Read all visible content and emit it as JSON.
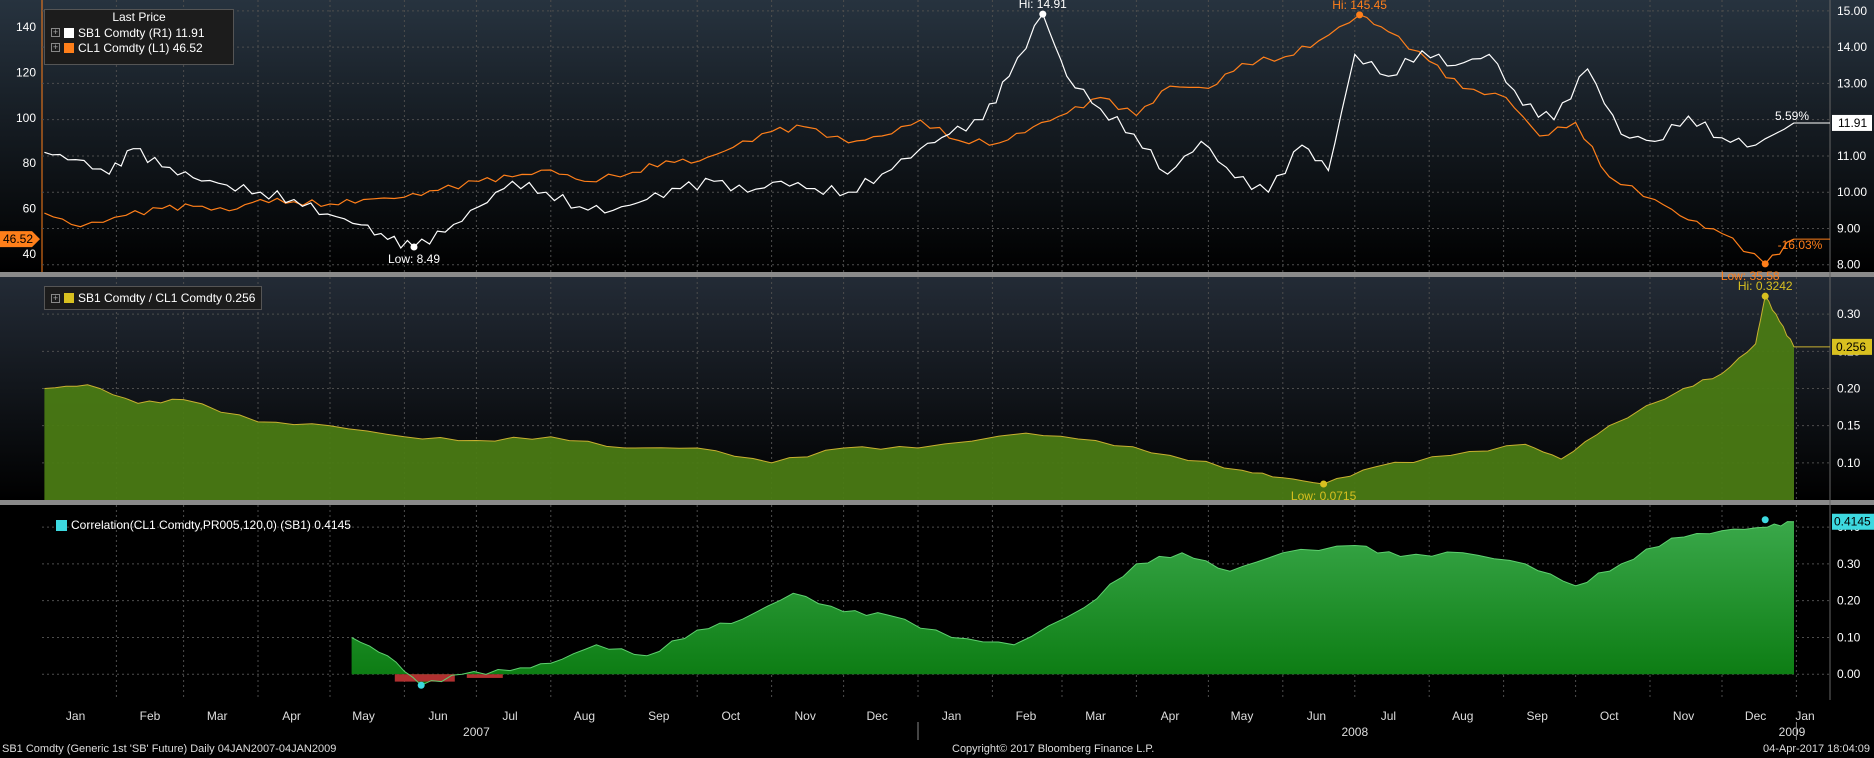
{
  "colors": {
    "sugar": "#ffffff",
    "crude": "#ff7f1a",
    "ratio_fill": "#4a7a14",
    "ratio_line": "#c8b030",
    "corr_fill": "#1f9a25",
    "corr_line": "#3dd9e0",
    "neg": "#b03030"
  },
  "legend_top": {
    "title": "Last Price",
    "items": [
      {
        "label": "SB1 Comdty  (R1) 11.91",
        "color": "#ffffff"
      },
      {
        "label": "CL1 Comdty  (L1) 46.52",
        "color": "#ff7f1a"
      }
    ]
  },
  "legend_mid": {
    "label": "SB1 Comdty / CL1 Comdty 0.256",
    "color": "#d8c020"
  },
  "legend_bot": {
    "label": "Correlation(CL1 Comdty,PR005,120,0) (SB1) 0.4145",
    "color": "#3dd9e0"
  },
  "footer": {
    "left": "SB1 Comdty (Generic 1st 'SB' Future)  Daily 04JAN2007-04JAN2009",
    "center": "Copyright© 2017 Bloomberg Finance L.P.",
    "right": "04-Apr-2017 18:04:09"
  },
  "chart_data": [
    {
      "type": "line",
      "panel": "price",
      "x_domain": [
        "2007-01-01",
        "2009-01-15"
      ],
      "y_left_ticks": [
        40,
        60,
        80,
        100,
        120,
        140
      ],
      "y_left_range": [
        32,
        152
      ],
      "y_right_ticks": [
        "8.00",
        "9.00",
        "10.00",
        "11.00",
        "12.00",
        "13.00",
        "14.00",
        "15.00"
      ],
      "y_right_range": [
        7.8,
        15.3
      ],
      "series": [
        {
          "name": "SB1 Comdty (R1)",
          "axis": "right",
          "last": "11.91",
          "points": [
            [
              "2007-01-02",
              11.1
            ],
            [
              "2007-01-15",
              10.9
            ],
            [
              "2007-01-29",
              10.5
            ],
            [
              "2007-02-08",
              11.2
            ],
            [
              "2007-02-20",
              10.7
            ],
            [
              "2007-03-05",
              10.4
            ],
            [
              "2007-03-19",
              10.2
            ],
            [
              "2007-04-02",
              10.0
            ],
            [
              "2007-04-16",
              9.8
            ],
            [
              "2007-04-30",
              9.4
            ],
            [
              "2007-05-14",
              9.1
            ],
            [
              "2007-05-25",
              8.7
            ],
            [
              "2007-06-05",
              8.49
            ],
            [
              "2007-06-18",
              8.9
            ],
            [
              "2007-07-02",
              9.6
            ],
            [
              "2007-07-16",
              10.3
            ],
            [
              "2007-07-30",
              10.0
            ],
            [
              "2007-08-13",
              9.6
            ],
            [
              "2007-08-27",
              9.5
            ],
            [
              "2007-09-10",
              9.8
            ],
            [
              "2007-09-24",
              10.1
            ],
            [
              "2007-10-08",
              10.3
            ],
            [
              "2007-10-22",
              10.0
            ],
            [
              "2007-11-05",
              10.3
            ],
            [
              "2007-11-19",
              10.1
            ],
            [
              "2007-12-03",
              10.0
            ],
            [
              "2007-12-17",
              10.5
            ],
            [
              "2008-01-02",
              11.2
            ],
            [
              "2008-01-14",
              11.6
            ],
            [
              "2008-01-28",
              12.0
            ],
            [
              "2008-02-08",
              13.2
            ],
            [
              "2008-02-22",
              14.91
            ],
            [
              "2008-03-03",
              13.2
            ],
            [
              "2008-03-17",
              12.3
            ],
            [
              "2008-03-31",
              11.6
            ],
            [
              "2008-04-14",
              10.5
            ],
            [
              "2008-04-28",
              11.4
            ],
            [
              "2008-05-12",
              10.4
            ],
            [
              "2008-05-26",
              10.0
            ],
            [
              "2008-06-09",
              11.3
            ],
            [
              "2008-06-20",
              10.6
            ],
            [
              "2008-07-01",
              13.8
            ],
            [
              "2008-07-15",
              13.2
            ],
            [
              "2008-07-29",
              13.9
            ],
            [
              "2008-08-12",
              13.5
            ],
            [
              "2008-08-26",
              13.8
            ],
            [
              "2008-09-09",
              12.4
            ],
            [
              "2008-09-22",
              12.0
            ],
            [
              "2008-10-06",
              13.4
            ],
            [
              "2008-10-20",
              11.6
            ],
            [
              "2008-11-03",
              11.4
            ],
            [
              "2008-11-17",
              12.1
            ],
            [
              "2008-12-01",
              11.5
            ],
            [
              "2008-12-15",
              11.3
            ],
            [
              "2008-12-31",
              11.91
            ]
          ]
        },
        {
          "name": "CL1 Comdty (L1)",
          "axis": "left",
          "last": "46.52",
          "points": [
            [
              "2007-01-02",
              58
            ],
            [
              "2007-01-17",
              52
            ],
            [
              "2007-02-05",
              57
            ],
            [
              "2007-02-20",
              60
            ],
            [
              "2007-03-05",
              61
            ],
            [
              "2007-03-20",
              59
            ],
            [
              "2007-04-02",
              64
            ],
            [
              "2007-04-16",
              63
            ],
            [
              "2007-05-01",
              62
            ],
            [
              "2007-05-15",
              64
            ],
            [
              "2007-06-01",
              65
            ],
            [
              "2007-06-15",
              68
            ],
            [
              "2007-07-02",
              72
            ],
            [
              "2007-07-16",
              74
            ],
            [
              "2007-08-01",
              77
            ],
            [
              "2007-08-15",
              72
            ],
            [
              "2007-09-04",
              76
            ],
            [
              "2007-09-18",
              81
            ],
            [
              "2007-10-02",
              81
            ],
            [
              "2007-10-16",
              87
            ],
            [
              "2007-11-01",
              94
            ],
            [
              "2007-11-15",
              96
            ],
            [
              "2007-12-03",
              89
            ],
            [
              "2007-12-17",
              92
            ],
            [
              "2008-01-02",
              99
            ],
            [
              "2008-01-18",
              90
            ],
            [
              "2008-02-04",
              89
            ],
            [
              "2008-02-18",
              96
            ],
            [
              "2008-03-03",
              102
            ],
            [
              "2008-03-17",
              109
            ],
            [
              "2008-04-01",
              101
            ],
            [
              "2008-04-15",
              114
            ],
            [
              "2008-05-01",
              113
            ],
            [
              "2008-05-15",
              124
            ],
            [
              "2008-06-02",
              127
            ],
            [
              "2008-06-16",
              134
            ],
            [
              "2008-07-03",
              145.45
            ],
            [
              "2008-07-15",
              138
            ],
            [
              "2008-08-01",
              125
            ],
            [
              "2008-08-15",
              113
            ],
            [
              "2008-09-02",
              109
            ],
            [
              "2008-09-16",
              92
            ],
            [
              "2008-10-01",
              98
            ],
            [
              "2008-10-15",
              74
            ],
            [
              "2008-11-03",
              64
            ],
            [
              "2008-11-17",
              55
            ],
            [
              "2008-12-01",
              49
            ],
            [
              "2008-12-19",
              35.58
            ],
            [
              "2008-12-31",
              46.52
            ]
          ]
        }
      ],
      "annotations": [
        {
          "text": "Hi: 14.91",
          "x": "2008-02-22",
          "y": 14.91,
          "axis": "right"
        },
        {
          "text": "Low: 8.49",
          "x": "2007-06-05",
          "y": 8.49,
          "axis": "right"
        },
        {
          "text": "Hi: 145.45",
          "x": "2008-07-03",
          "y": 145.45,
          "axis": "left"
        },
        {
          "text": "Low: 35.58",
          "x": "2008-12-19",
          "y": 35.58,
          "axis": "left"
        },
        {
          "text": "5.59%",
          "series": "SB1"
        },
        {
          "text": "-16.03%",
          "series": "CL1"
        }
      ]
    },
    {
      "type": "area",
      "panel": "ratio",
      "series_name": "SB1 Comdty / CL1 Comdty",
      "last": "0.256",
      "y_ticks": [
        "0.10",
        "0.15",
        "0.20",
        "0.25",
        "0.30"
      ],
      "y_range": [
        0.05,
        0.35
      ],
      "points": [
        [
          "2007-01-02",
          0.2
        ],
        [
          "2007-01-20",
          0.205
        ],
        [
          "2007-02-10",
          0.18
        ],
        [
          "2007-03-01",
          0.185
        ],
        [
          "2007-04-01",
          0.155
        ],
        [
          "2007-05-01",
          0.15
        ],
        [
          "2007-06-01",
          0.135
        ],
        [
          "2007-07-01",
          0.13
        ],
        [
          "2007-08-01",
          0.135
        ],
        [
          "2007-09-01",
          0.12
        ],
        [
          "2007-10-01",
          0.12
        ],
        [
          "2007-11-01",
          0.1
        ],
        [
          "2007-12-01",
          0.12
        ],
        [
          "2008-01-01",
          0.12
        ],
        [
          "2008-02-15",
          0.14
        ],
        [
          "2008-03-15",
          0.13
        ],
        [
          "2008-04-15",
          0.11
        ],
        [
          "2008-05-15",
          0.09
        ],
        [
          "2008-06-01",
          0.08
        ],
        [
          "2008-06-18",
          0.0715
        ],
        [
          "2008-07-10",
          0.095
        ],
        [
          "2008-08-10",
          0.11
        ],
        [
          "2008-09-10",
          0.125
        ],
        [
          "2008-09-25",
          0.105
        ],
        [
          "2008-10-15",
          0.15
        ],
        [
          "2008-11-15",
          0.2
        ],
        [
          "2008-12-01",
          0.22
        ],
        [
          "2008-12-15",
          0.26
        ],
        [
          "2008-12-19",
          0.3242
        ],
        [
          "2008-12-25",
          0.29
        ],
        [
          "2008-12-31",
          0.256
        ]
      ],
      "annotations": [
        {
          "text": "Hi: 0.3242",
          "x": "2008-12-19",
          "y": 0.3242
        },
        {
          "text": "Low: 0.0715",
          "x": "2008-06-18",
          "y": 0.0715
        }
      ]
    },
    {
      "type": "area",
      "panel": "correlation",
      "series_name": "Correlation(CL1 Comdty,PR005,120,0) (SB1)",
      "last": "0.4145",
      "y_ticks": [
        "0.00",
        "0.10",
        "0.20",
        "0.30",
        "0.40"
      ],
      "y_range": [
        -0.07,
        0.46
      ],
      "points": [
        [
          "2007-05-10",
          0.1
        ],
        [
          "2007-05-25",
          0.05
        ],
        [
          "2007-06-08",
          -0.03
        ],
        [
          "2007-06-25",
          0.0
        ],
        [
          "2007-07-15",
          0.01
        ],
        [
          "2007-08-01",
          0.03
        ],
        [
          "2007-08-20",
          0.08
        ],
        [
          "2007-09-10",
          0.05
        ],
        [
          "2007-10-01",
          0.12
        ],
        [
          "2007-10-20",
          0.15
        ],
        [
          "2007-11-10",
          0.22
        ],
        [
          "2007-12-01",
          0.17
        ],
        [
          "2007-12-20",
          0.16
        ],
        [
          "2008-01-15",
          0.1
        ],
        [
          "2008-02-10",
          0.08
        ],
        [
          "2008-03-10",
          0.18
        ],
        [
          "2008-04-01",
          0.3
        ],
        [
          "2008-04-20",
          0.33
        ],
        [
          "2008-05-10",
          0.28
        ],
        [
          "2008-06-01",
          0.33
        ],
        [
          "2008-07-01",
          0.35
        ],
        [
          "2008-07-20",
          0.32
        ],
        [
          "2008-08-15",
          0.33
        ],
        [
          "2008-09-10",
          0.3
        ],
        [
          "2008-10-01",
          0.24
        ],
        [
          "2008-10-20",
          0.3
        ],
        [
          "2008-11-10",
          0.37
        ],
        [
          "2008-12-01",
          0.39
        ],
        [
          "2008-12-20",
          0.4
        ],
        [
          "2008-12-31",
          0.4145
        ]
      ]
    }
  ],
  "x_axis": {
    "months": [
      "Jan",
      "Feb",
      "Mar",
      "Apr",
      "May",
      "Jun",
      "Jul",
      "Aug",
      "Sep",
      "Oct",
      "Nov",
      "Dec",
      "Jan",
      "Feb",
      "Mar",
      "Apr",
      "May",
      "Jun",
      "Jul",
      "Aug",
      "Sep",
      "Oct",
      "Nov",
      "Dec",
      "Jan"
    ],
    "years": [
      "2007",
      "2008",
      "2009"
    ]
  }
}
